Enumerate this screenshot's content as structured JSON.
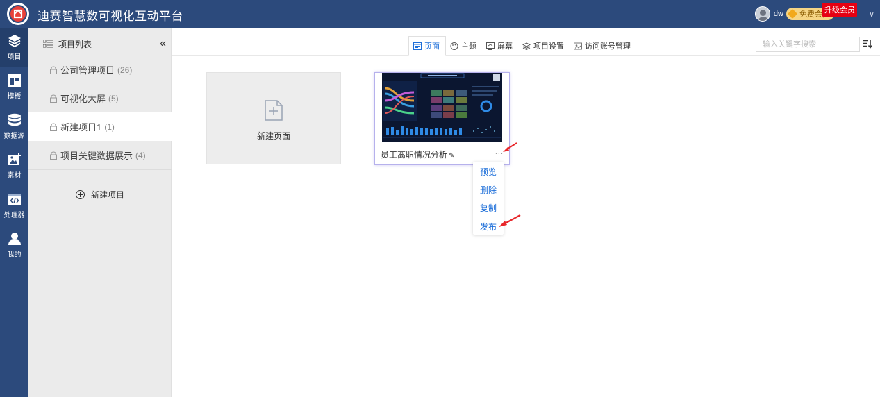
{
  "app": {
    "title": "迪赛智慧数可视化互动平台"
  },
  "user": {
    "name": "dw",
    "member_label": "免费会员",
    "upgrade_label": "升级会员"
  },
  "nav": {
    "items": [
      {
        "label": "项目",
        "icon": "layers-icon"
      },
      {
        "label": "模板",
        "icon": "template-icon"
      },
      {
        "label": "数据源",
        "icon": "database-icon"
      },
      {
        "label": "素材",
        "icon": "image-icon"
      },
      {
        "label": "处理器",
        "icon": "code-icon"
      },
      {
        "label": "我的",
        "icon": "user-icon"
      }
    ]
  },
  "project_panel": {
    "title": "项目列表",
    "items": [
      {
        "name": "公司管理项目",
        "count": "(26)"
      },
      {
        "name": "可视化大屏",
        "count": "(5)"
      },
      {
        "name": "新建项目1",
        "count": "(1)"
      },
      {
        "name": "项目关键数据展示",
        "count": "(4)"
      }
    ],
    "new_project_label": "新建项目"
  },
  "tabs": [
    {
      "label": "页面",
      "icon": "page-icon"
    },
    {
      "label": "主题",
      "icon": "theme-icon"
    },
    {
      "label": "屏幕",
      "icon": "screen-icon"
    },
    {
      "label": "项目设置",
      "icon": "settings-icon"
    },
    {
      "label": "访问账号管理",
      "icon": "account-icon"
    }
  ],
  "search": {
    "placeholder": "输入关键字搜索"
  },
  "content": {
    "new_page_label": "新建页面",
    "page_card": {
      "name": "员工离职情况分析",
      "more": "..."
    }
  },
  "menu": {
    "items": [
      {
        "label": "预览"
      },
      {
        "label": "删除"
      },
      {
        "label": "复制"
      },
      {
        "label": "发布"
      }
    ]
  },
  "colors": {
    "header_bg": "#2c4a7c",
    "accent": "#1e6fd9",
    "upgrade": "#e60012",
    "annotation": "#e8262a"
  }
}
